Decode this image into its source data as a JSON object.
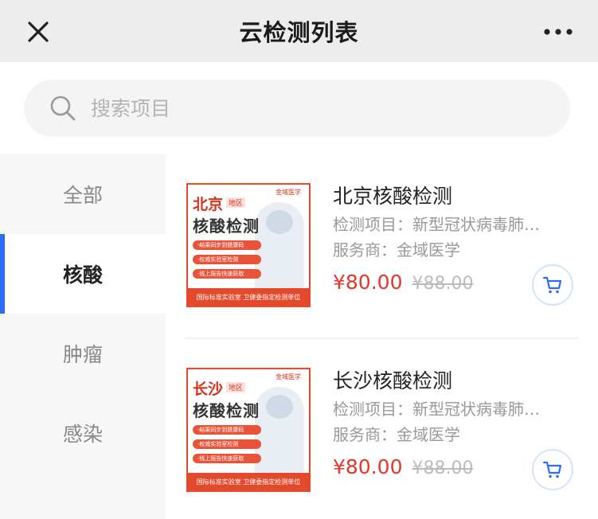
{
  "header": {
    "title": "云检测列表"
  },
  "search": {
    "placeholder": "搜索项目"
  },
  "sidebar": {
    "items": [
      {
        "label": "全部",
        "active": false
      },
      {
        "label": "核酸",
        "active": true
      },
      {
        "label": "肿瘤",
        "active": false
      },
      {
        "label": "感染",
        "active": false
      }
    ],
    "accent_color": "#2d6cf6"
  },
  "products": [
    {
      "name": "北京核酸检测",
      "item_line": "检测项目：新型冠状病毒肺…",
      "provider_line": "服务商：金域医学",
      "price": "¥80.00",
      "original_price": "¥88.00",
      "thumb": {
        "city": "北京",
        "tag": "地区",
        "main": "核酸检测",
        "logo": "金域医学",
        "bullets": [
          "·结果同步到健康码",
          "·权威实验室检测",
          "·线上报告快速获取"
        ],
        "band": "国际标准实验室 卫健委指定检测单位"
      }
    },
    {
      "name": "长沙核酸检测",
      "item_line": "检测项目：新型冠状病毒肺…",
      "provider_line": "服务商：金域医学",
      "price": "¥80.00",
      "original_price": "¥88.00",
      "thumb": {
        "city": "长沙",
        "tag": "地区",
        "main": "核酸检测",
        "logo": "金域医学",
        "bullets": [
          "·结果同步到健康码",
          "·权威实验室检测",
          "·线上报告快速获取"
        ],
        "band": "国际标准实验室 卫健委指定检测单位"
      }
    }
  ],
  "colors": {
    "price": "#e6352b",
    "brand_red": "#e24a2b"
  },
  "icons": {
    "close": "close-icon",
    "more": "more-icon",
    "search": "search-icon",
    "cart": "cart-icon"
  }
}
